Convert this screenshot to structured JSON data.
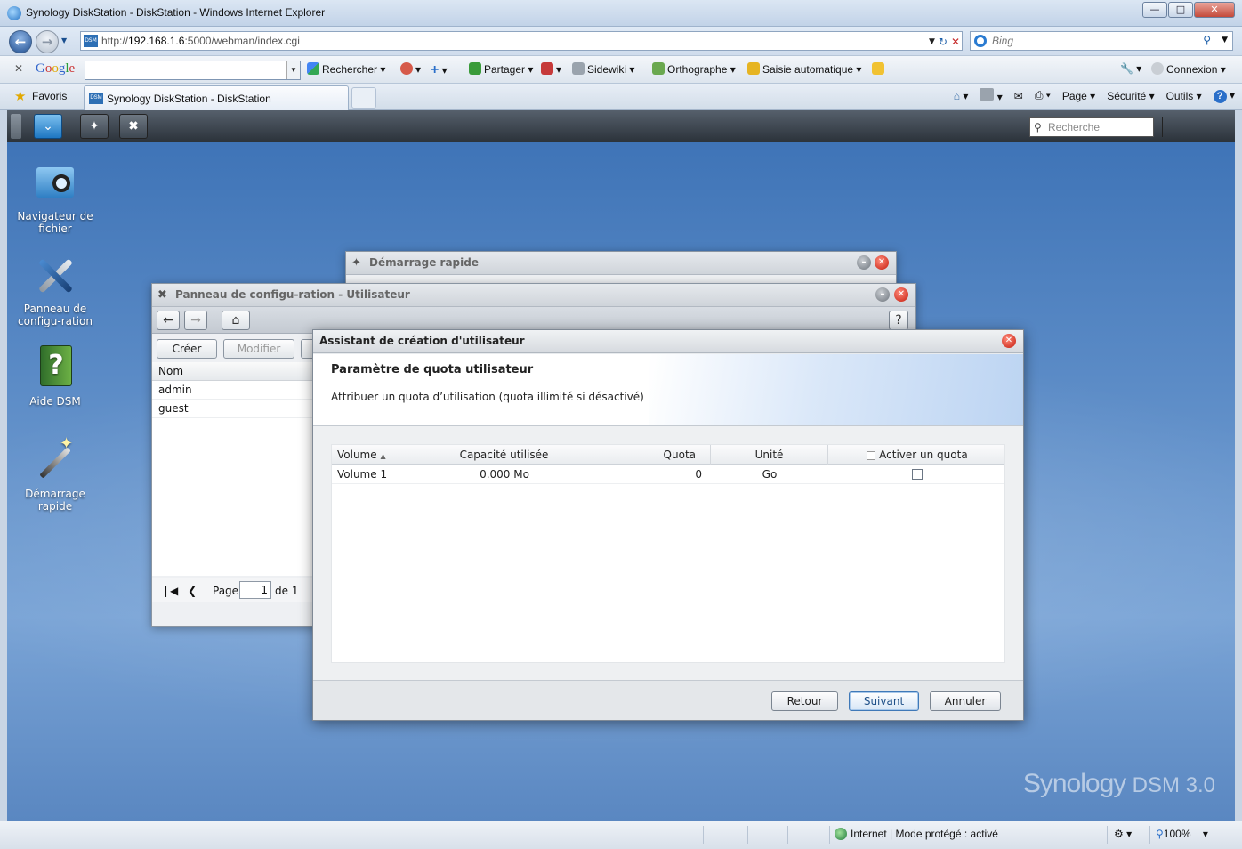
{
  "browser": {
    "window_title": "Synology DiskStation - DiskStation - Windows Internet Explorer",
    "url_prefix": "http://",
    "url_host": "192.168.1.6",
    "url_rest": ":5000/webman/index.cgi",
    "search_engine_placeholder": "Bing",
    "google_toolbar": {
      "rechercher": "Rechercher",
      "partager": "Partager",
      "sidewiki": "Sidewiki",
      "orthographe": "Orthographe",
      "saisie": "Saisie automatique",
      "connexion": "Connexion"
    },
    "favoris": "Favoris",
    "tab_title": "Synology DiskStation - DiskStation",
    "commands": {
      "page": "Page",
      "securite": "Sécurité",
      "outils": "Outils"
    },
    "status": {
      "zone": "Internet | Mode protégé : activé",
      "zoom": "100%"
    }
  },
  "dsm": {
    "search_placeholder": "Recherche",
    "desktop_icons": [
      {
        "label": "Navigateur de fichier"
      },
      {
        "label": "Panneau de configu-ration"
      },
      {
        "label": "Aide DSM"
      },
      {
        "label": "Démarrage rapide"
      }
    ],
    "brand": "Synology",
    "brand_suffix": "DSM 3.0",
    "quickstart_window": {
      "title": "Démarrage rapide"
    },
    "control_panel_window": {
      "title": "Panneau de configu-ration - Utilisateur",
      "create": "Créer",
      "modify": "Modifier",
      "column_name": "Nom",
      "users": [
        "admin",
        "guest"
      ],
      "page_label": "Page",
      "page_value": "1",
      "page_of": "de 1",
      "help": "?"
    },
    "wizard": {
      "title": "Assistant de création d'utilisateur",
      "heading": "Paramètre de quota utilisateur",
      "description": "Attribuer un quota d’utilisation (quota illimité si désactivé)",
      "columns": {
        "volume": "Volume",
        "used": "Capacité utilisée",
        "quota": "Quota",
        "unit": "Unité",
        "enable": "Activer un quota"
      },
      "rows": [
        {
          "volume": "Volume 1",
          "used": "0.000 Mo",
          "quota": "0",
          "unit": "Go",
          "enabled": false
        }
      ],
      "buttons": {
        "back": "Retour",
        "next": "Suivant",
        "cancel": "Annuler"
      }
    }
  },
  "colors": {
    "desktop_blue": "#5b8bc6",
    "accent": "#1e77c2",
    "close_red": "#c51c0e"
  }
}
